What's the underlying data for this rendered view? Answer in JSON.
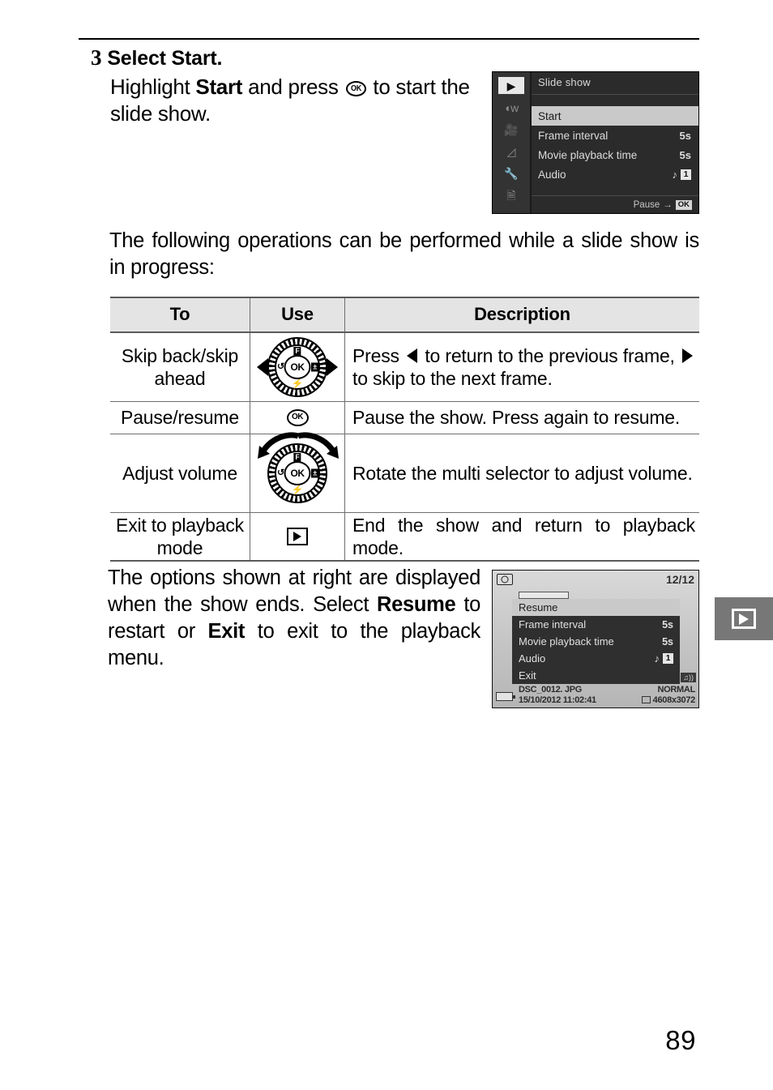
{
  "page": {
    "number": "89"
  },
  "step": {
    "number": "3",
    "title_prefix": "Select ",
    "title_bold": "Start.",
    "body_1": "Highlight ",
    "body_bold": "Start",
    "body_2": " and press ",
    "body_3": " to start the slide show."
  },
  "menu_screen": {
    "title": "Slide show",
    "sidebar_icons": [
      "playback-icon",
      "shooting-icon",
      "movie-icon",
      "retouch-icon",
      "setup-wrench-icon",
      "recent-settings-icon"
    ],
    "rows": [
      {
        "label": "Start",
        "value": "",
        "highlighted": true
      },
      {
        "label": "Frame interval",
        "value": "5s",
        "highlighted": false
      },
      {
        "label": "Movie playback time",
        "value": "5s",
        "highlighted": false
      },
      {
        "label": "Audio",
        "value": "",
        "note": "♪",
        "badge": "1",
        "highlighted": false
      }
    ],
    "footer_label": "Pause",
    "footer_arrow": "→",
    "footer_button": "OK"
  },
  "intro_paragraph": "The following operations can be performed while a slide show is in progress:",
  "table": {
    "headers": [
      "To",
      "Use",
      "Description"
    ],
    "rows": [
      {
        "to": "Skip back/skip ahead",
        "use_icon": "multi-selector-left-right-icon",
        "desc_pre": "Press ",
        "desc_mid": " to return to the previous frame, ",
        "desc_post": " to skip to the next frame."
      },
      {
        "to": "Pause/resume",
        "use_icon": "ok-button-icon",
        "use_label": "OK",
        "desc": "Pause the show. Press again to resume."
      },
      {
        "to": "Adjust volume",
        "use_icon": "multi-selector-rotate-icon",
        "desc": "Rotate the multi selector to adjust volume."
      },
      {
        "to": "Exit to playback mode",
        "use_icon": "playback-button-icon",
        "desc": "End the show and return to playback mode."
      }
    ]
  },
  "dial_labels": {
    "top": "F",
    "bottom": "⚡",
    "left": "↺",
    "right": "±",
    "center": "OK"
  },
  "outro": {
    "part_1": "The options shown at right are displayed when the show ends. Select ",
    "bold_1": "Resume",
    "part_2": " to restart or ",
    "bold_2": "Exit",
    "part_3": " to exit to the playback menu."
  },
  "playback_screen": {
    "frame_counter": "12/12",
    "camera_icon": "camera-icon",
    "rows": [
      {
        "label": "Resume",
        "value": "",
        "highlighted": true
      },
      {
        "label": "Frame interval",
        "value": "5s",
        "highlighted": false
      },
      {
        "label": "Movie playback time",
        "value": "5s",
        "highlighted": false
      },
      {
        "label": "Audio",
        "value": "",
        "note": "♪",
        "badge": "1",
        "highlighted": false
      },
      {
        "label": "Exit",
        "value": "",
        "highlighted": false
      }
    ],
    "filename": "DSC_0012. JPG",
    "quality": "NORMAL",
    "date": "15/10/2012  11:02:41",
    "dimensions": "4608x3072",
    "speaker_icon": "speaker-icon"
  },
  "margin_tab": {
    "icon": "playback-icon"
  }
}
